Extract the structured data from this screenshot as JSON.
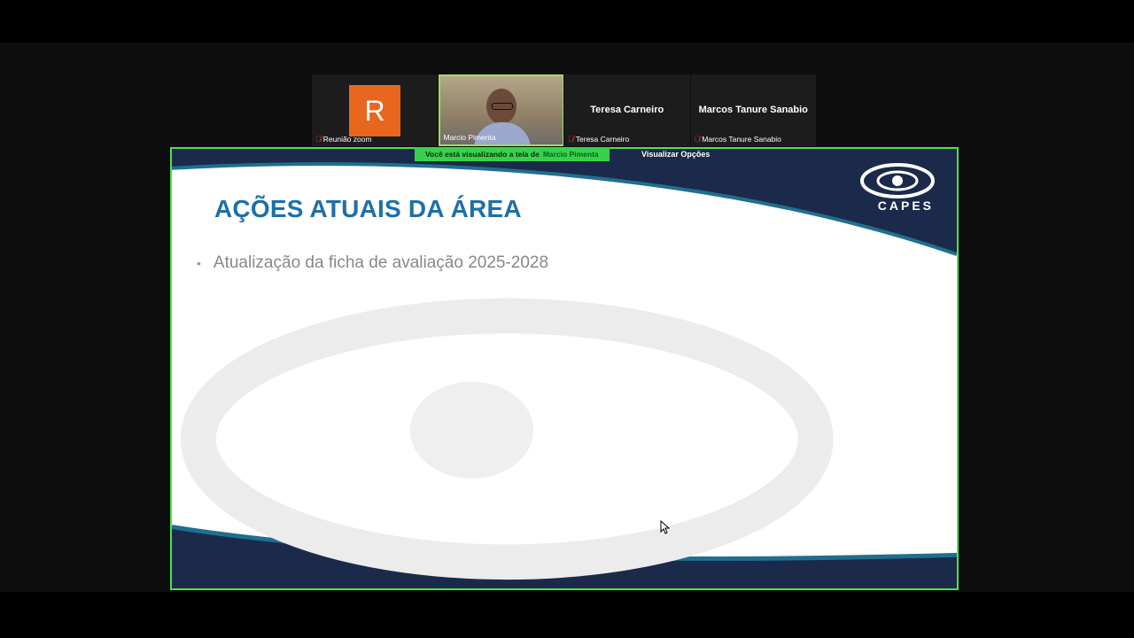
{
  "participants": [
    {
      "initial": "R",
      "label": "Reunião zoom",
      "muted": true
    },
    {
      "label": "Marcio Pimenta",
      "muted": false,
      "has_video": true
    },
    {
      "display_name": "Teresa Carneiro",
      "label": "Teresa Carneiro",
      "muted": true
    },
    {
      "display_name": "Marcos Tanure Sanabio",
      "label": "Marcos Tanure Sanabio",
      "muted": true
    }
  ],
  "share_banner": {
    "prefix": "Você está visualizando a tela de",
    "presenter": "Marcio Pimenta",
    "view_options": "Visualizar Opções"
  },
  "slide": {
    "title": "AÇÕES ATUAIS DA ÁREA",
    "bullets": [
      "Atualização da ficha de avaliação 2025-2028"
    ],
    "logo_text": "CAPES"
  },
  "colors": {
    "share_border": "#4ee24c",
    "title": "#1d6fa8",
    "slide_navy": "#1b2a4a",
    "avatar_orange": "#e8661e"
  }
}
